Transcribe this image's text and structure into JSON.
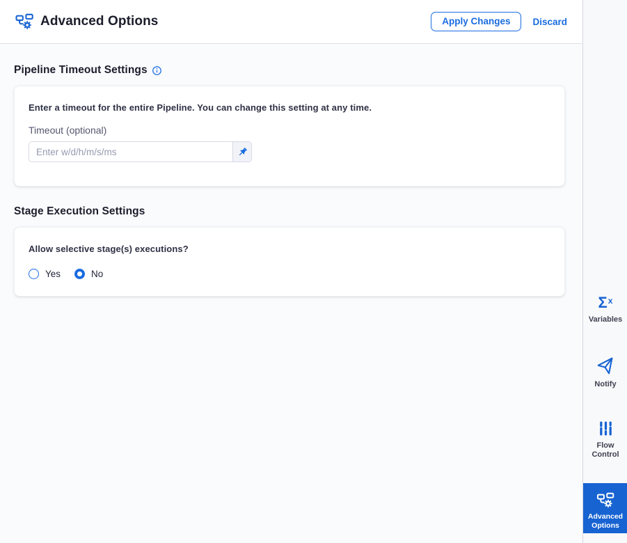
{
  "header": {
    "title": "Advanced Options",
    "apply_label": "Apply Changes",
    "discard_label": "Discard"
  },
  "pipeline_timeout": {
    "heading": "Pipeline Timeout Settings",
    "info_icon": "info-icon",
    "description": "Enter a timeout for the entire Pipeline. You can change this setting at any time.",
    "timeout_label": "Timeout (optional)",
    "timeout_placeholder": "Enter w/d/h/m/s/ms",
    "timeout_value": "",
    "input_type_icon": "pin-icon"
  },
  "stage_execution": {
    "heading": "Stage Execution Settings",
    "question": "Allow selective stage(s) executions?",
    "options": [
      {
        "label": "Yes",
        "selected": false
      },
      {
        "label": "No",
        "selected": true
      }
    ]
  },
  "sidebar": {
    "items": [
      {
        "label": "Variables",
        "icon": "sigma-x-icon",
        "active": false
      },
      {
        "label": "Notify",
        "icon": "paper-plane-icon",
        "active": false
      },
      {
        "label": "Flow Control",
        "icon": "sliders-icon",
        "active": false
      },
      {
        "label": "Advanced Options",
        "icon": "pipeline-gear-icon",
        "active": true
      }
    ]
  },
  "colors": {
    "primary_blue": "#1a6ce0",
    "icon_blue": "#1763d2",
    "active_tile_bg": "#1763d2",
    "heading_text": "#1c1d2b",
    "main_background": "#fafbfd",
    "sidebar_background": "#f8f9fb"
  }
}
